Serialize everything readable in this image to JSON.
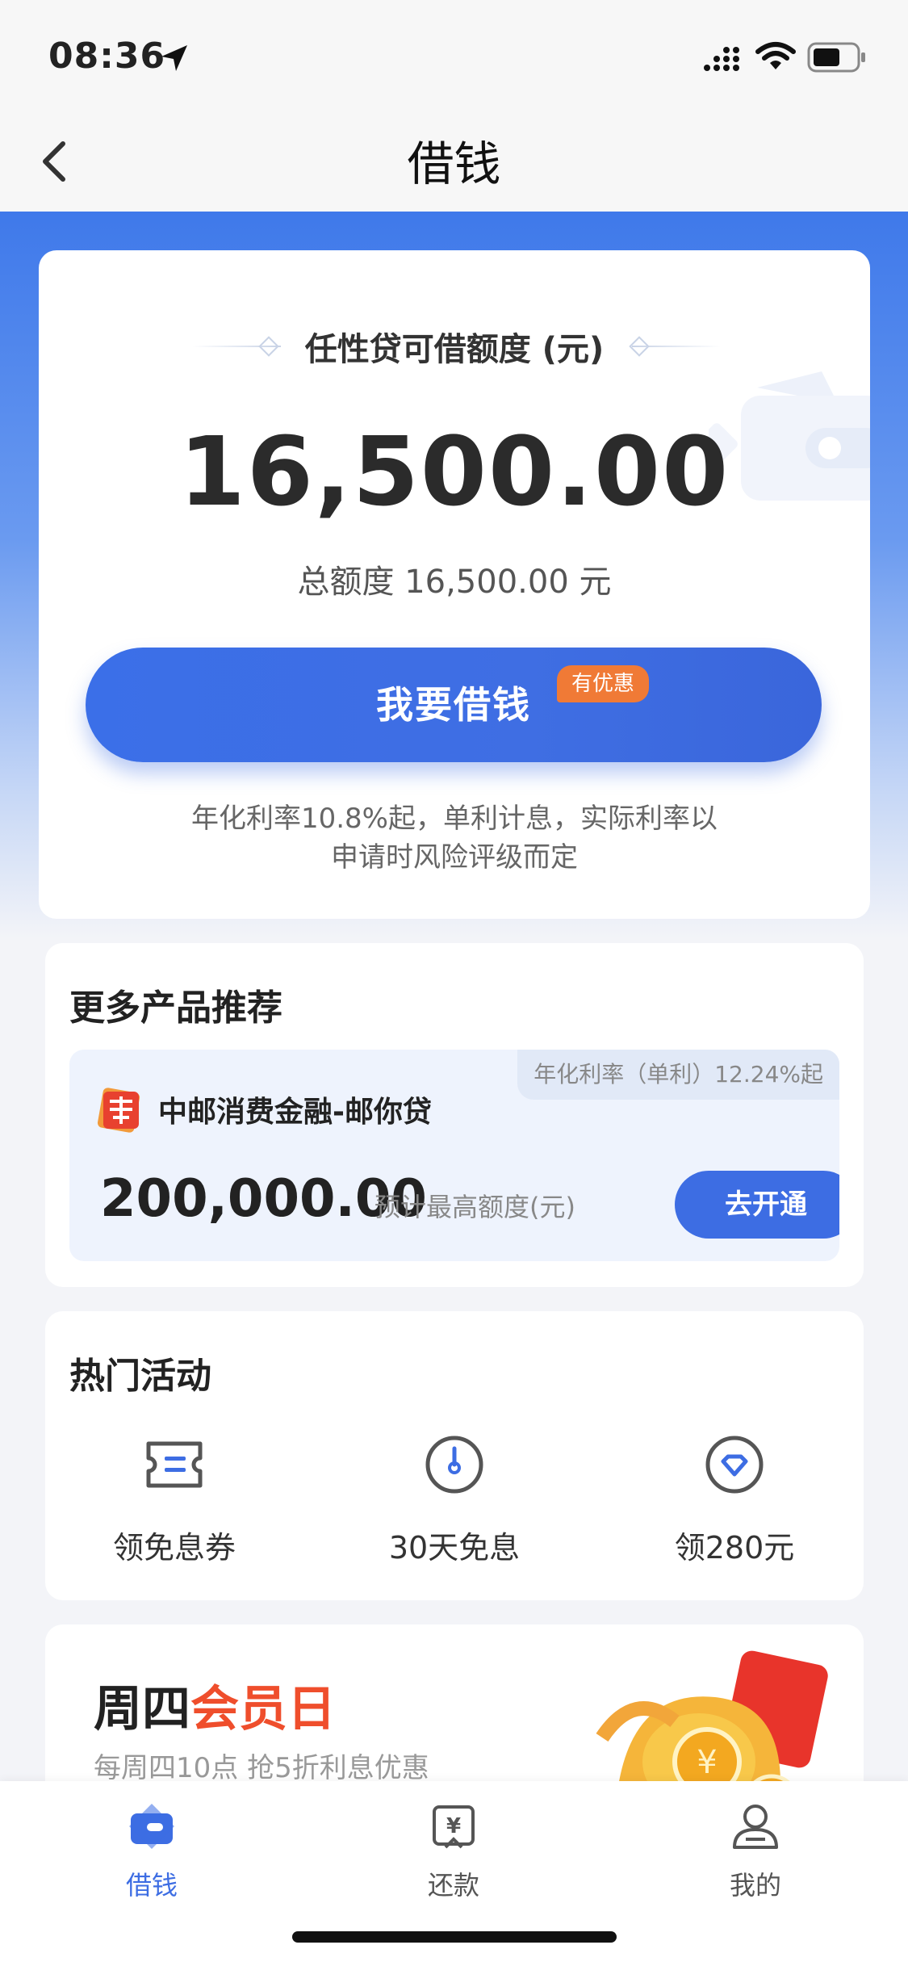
{
  "status_bar": {
    "time": "08:36"
  },
  "nav": {
    "title": "借钱"
  },
  "credit": {
    "title": "任性贷可借额度 (元)",
    "amount": "16,500.00",
    "total": "总额度 16,500.00 元",
    "borrow_button": "我要借钱",
    "promo_badge": "有优惠",
    "rate_note_line1": "年化利率10.8%起，单利计息，实际利率以",
    "rate_note_line2": "申请时风险评级而定"
  },
  "products": {
    "title": "更多产品推荐",
    "item": {
      "rate_tag": "年化利率（单利）12.24%起",
      "name": "中邮消费金融-邮你贷",
      "amount": "200,000.00",
      "amount_label": "预计最高额度(元)",
      "open_button": "去开通"
    }
  },
  "activities": {
    "title": "热门活动",
    "items": [
      {
        "label": "领免息券",
        "icon": "coupon-icon"
      },
      {
        "label": "30天免息",
        "icon": "clock-icon"
      },
      {
        "label": "领280元",
        "icon": "heart-badge-icon"
      }
    ]
  },
  "member_day": {
    "title_part1": "周四",
    "title_part2": "会员日",
    "subtitle": "每周四10点 抢5折利息优惠"
  },
  "tabbar": {
    "tabs": [
      {
        "label": "借钱",
        "icon": "wallet-icon",
        "active": true
      },
      {
        "label": "还款",
        "icon": "repay-icon",
        "active": false
      },
      {
        "label": "我的",
        "icon": "profile-icon",
        "active": false
      }
    ]
  },
  "colors": {
    "accent": "#3d6de3",
    "promo": "#f07a36",
    "member_red": "#ef4e2c"
  }
}
